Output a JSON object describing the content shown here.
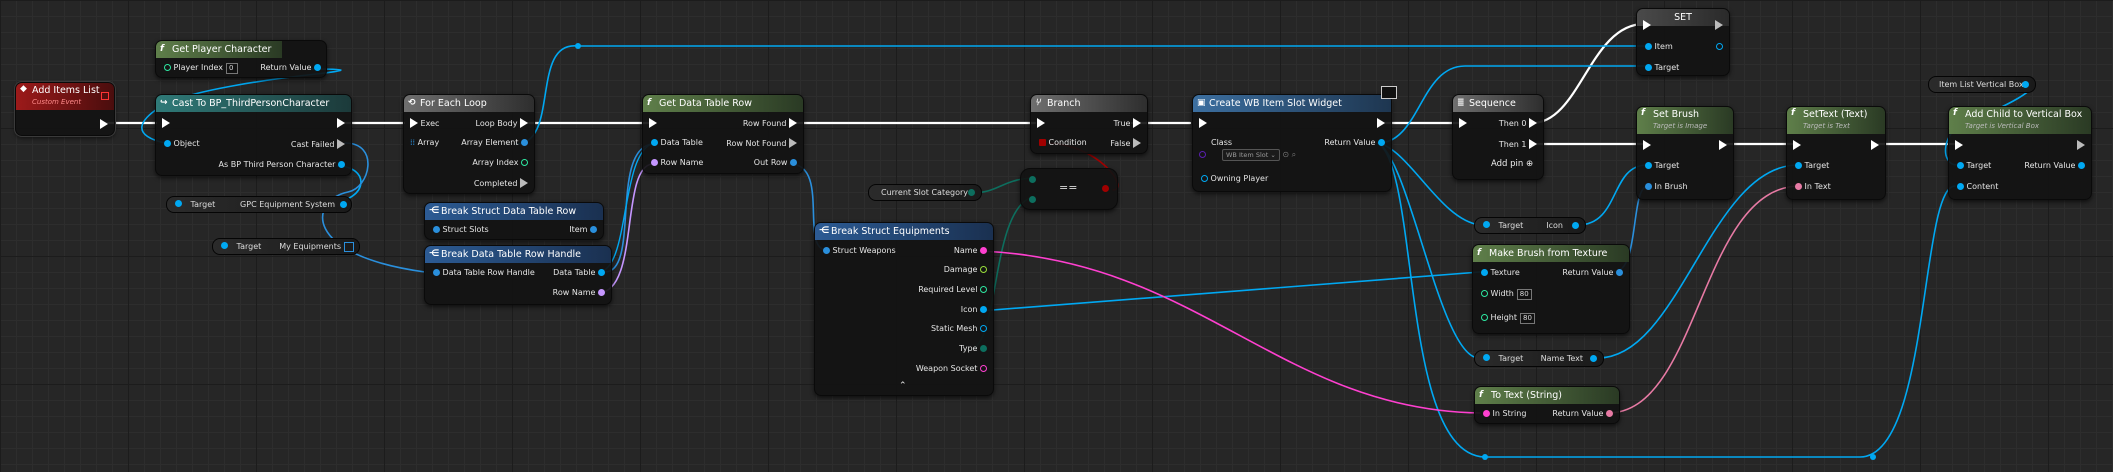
{
  "colors": {
    "exec": "#ffffff",
    "object": "#00a8f2",
    "struct": "#1e78d6",
    "string": "#ff40d0",
    "text": "#e77aa4",
    "int": "#2ee8a2",
    "bool": "#a00000",
    "class": "#5a1fb1",
    "name": "#c596ff",
    "byte": "#0d6e5e"
  },
  "nodes": {
    "add_items_list": {
      "title": "Add Items List",
      "subtitle": "Custom Event"
    },
    "get_player_character": {
      "title": "Get Player Character",
      "player_index_label": "Player Index",
      "player_index_value": "0",
      "return_label": "Return Value"
    },
    "cast": {
      "title": "Cast To BP_ThirdPersonCharacter",
      "object": "Object",
      "cast_failed": "Cast Failed",
      "as_label": "As BP Third Person Character"
    },
    "gpc_getter": {
      "target": "Target",
      "label": "GPC Equipment System"
    },
    "my_equipments": {
      "target": "Target",
      "label": "My Equipments"
    },
    "for_each": {
      "title": "For Each Loop",
      "exec": "Exec",
      "loop_body": "Loop Body",
      "array": "Array",
      "array_element": "Array Element",
      "array_index": "Array Index",
      "completed": "Completed"
    },
    "break_row": {
      "title": "Break Struct Data Table Row",
      "slots": "Struct Slots",
      "item": "Item"
    },
    "break_handle": {
      "title": "Break Data Table Row Handle",
      "handle": "Data Table Row Handle",
      "data_table": "Data Table",
      "row_name": "Row Name"
    },
    "get_row": {
      "title": "Get Data Table Row",
      "row_found": "Row Found",
      "row_not_found": "Row Not Found",
      "data_table": "Data Table",
      "row_name": "Row Name",
      "out_row": "Out Row"
    },
    "current_slot": {
      "label": "Current Slot Category"
    },
    "equal": {
      "symbol": "=="
    },
    "branch": {
      "title": "Branch",
      "condition": "Condition",
      "true_label": "True",
      "false_label": "False"
    },
    "break_equip": {
      "title": "Break Struct Equipments",
      "struct_weapons": "Struct Weapons",
      "name": "Name",
      "damage": "Damage",
      "required_level": "Required Level",
      "icon": "Icon",
      "static_mesh": "Static Mesh",
      "type": "Type",
      "weapon_socket": "Weapon Socket",
      "expand": "⌃"
    },
    "create_widget": {
      "title": "Create WB Item Slot Widget",
      "class": "Class",
      "class_value": "WB Item Slot",
      "return_label": "Return Value",
      "owning_player": "Owning Player"
    },
    "sequence": {
      "title": "Sequence",
      "then0": "Then 0",
      "then1": "Then 1",
      "add_pin": "Add pin"
    },
    "set_node": {
      "title": "SET",
      "item": "Item",
      "target": "Target"
    },
    "target_icon": {
      "target": "Target",
      "label": "Icon"
    },
    "make_brush": {
      "title": "Make Brush from Texture",
      "texture": "Texture",
      "return_label": "Return Value",
      "width": "Width",
      "width_value": "80",
      "height": "Height",
      "height_value": "80"
    },
    "target_name_text": {
      "target": "Target",
      "label": "Name Text"
    },
    "to_text": {
      "title": "To Text (String)",
      "in_string": "In String",
      "return_label": "Return Value"
    },
    "set_brush": {
      "title": "Set Brush",
      "subtitle": "Target is Image",
      "target": "Target",
      "in_brush": "In Brush"
    },
    "set_text": {
      "title": "SetText (Text)",
      "subtitle": "Target is Text",
      "target": "Target",
      "in_text": "In Text"
    },
    "item_list_vbox": {
      "label": "Item List Vertical Box"
    },
    "add_child": {
      "title": "Add Child to Vertical Box",
      "subtitle": "Target is Vertical Box",
      "target": "Target",
      "return_label": "Return Value",
      "content": "Content"
    }
  }
}
